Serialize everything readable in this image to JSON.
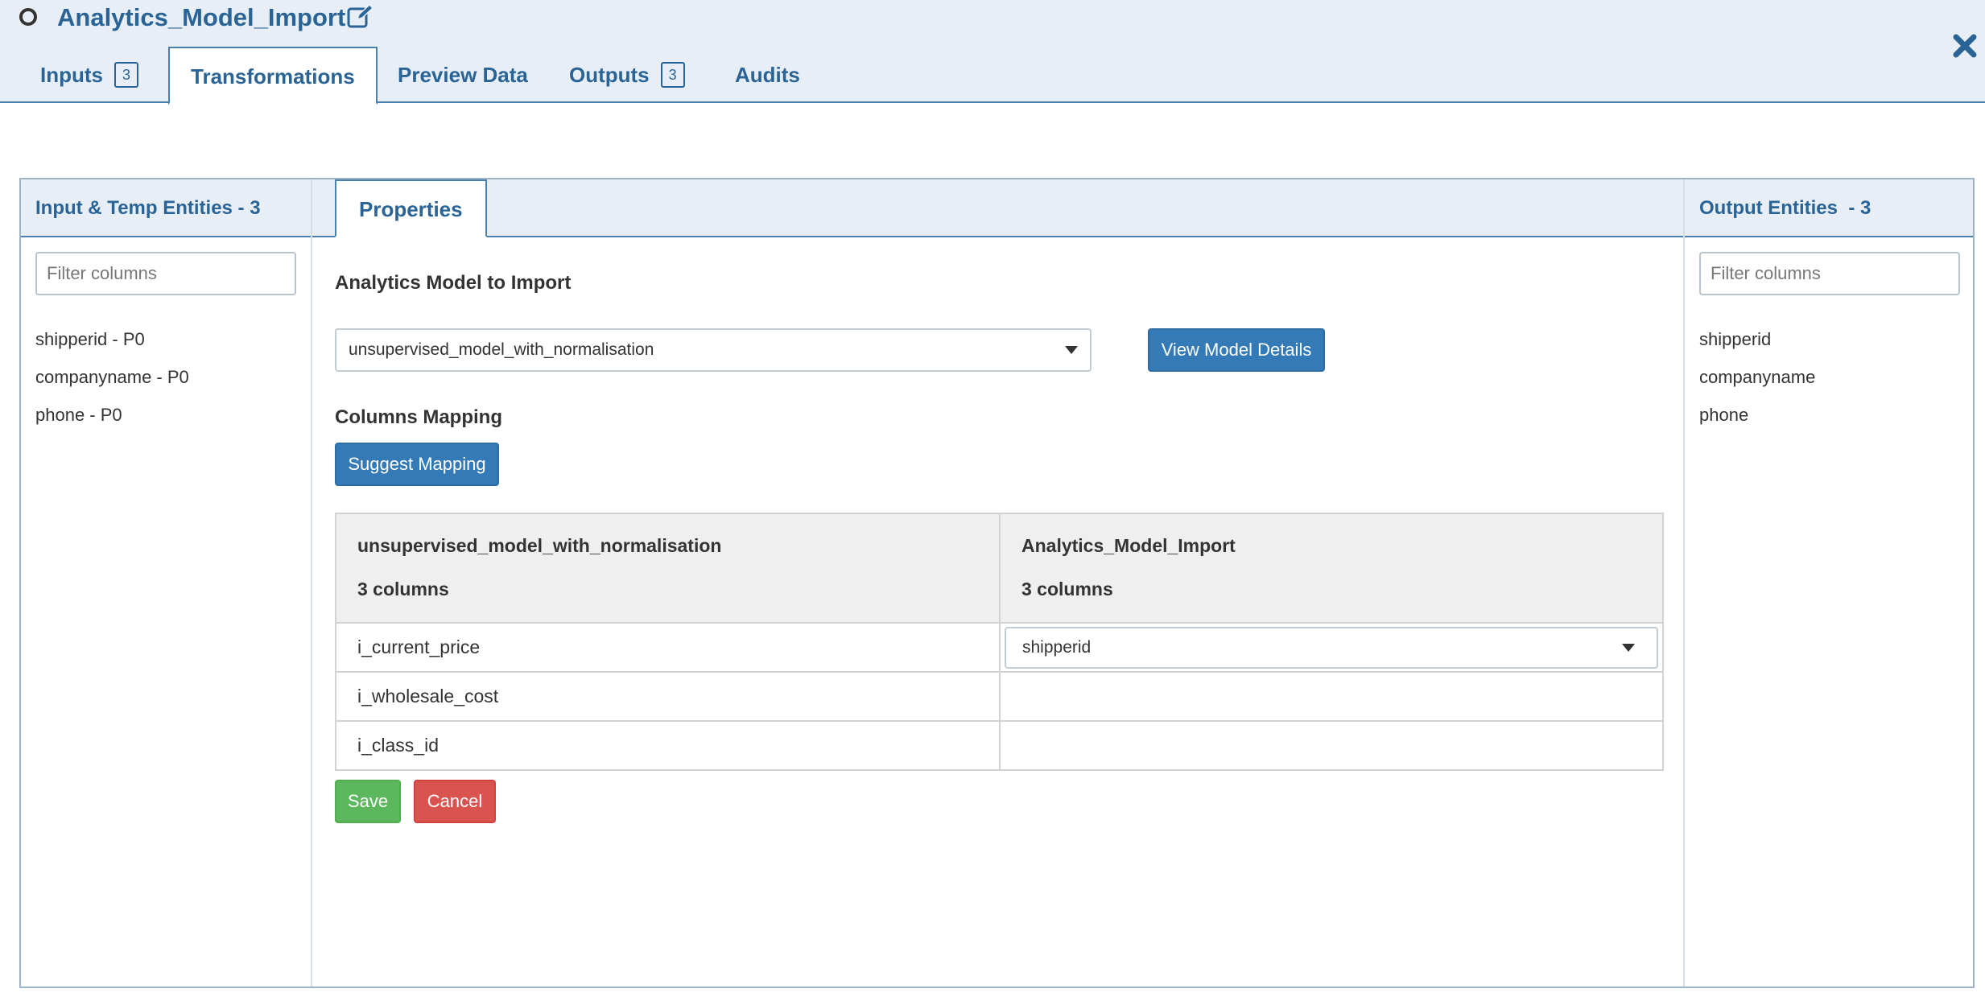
{
  "header": {
    "title": "Analytics_Model_Import",
    "tabs": [
      {
        "label": "Inputs",
        "badge": "3"
      },
      {
        "label": "Transformations"
      },
      {
        "label": "Preview Data"
      },
      {
        "label": "Outputs",
        "badge": "3"
      },
      {
        "label": "Audits"
      }
    ],
    "active_tab": "Transformations"
  },
  "left_panel": {
    "title": "Input & Temp Entities - 3",
    "filter_placeholder": "Filter columns",
    "items": [
      "shipperid - P0",
      "companyname - P0",
      "phone - P0"
    ]
  },
  "center": {
    "tab": "Properties",
    "model_label": "Analytics Model to Import",
    "model_selected": "unsupervised_model_with_normalisation",
    "view_details_button": "View Model Details",
    "columns_mapping_label": "Columns Mapping",
    "suggest_mapping_button": "Suggest Mapping",
    "table": {
      "left_header_name": "unsupervised_model_with_normalisation",
      "left_header_count": "3 columns",
      "right_header_name": "Analytics_Model_Import",
      "right_header_count": "3 columns",
      "rows": [
        {
          "source": "i_current_price",
          "target": "shipperid"
        },
        {
          "source": "i_wholesale_cost",
          "target": ""
        },
        {
          "source": "i_class_id",
          "target": ""
        }
      ]
    },
    "save_button": "Save",
    "cancel_button": "Cancel"
  },
  "right_panel": {
    "title": "Output Entities  - 3",
    "filter_placeholder": "Filter columns",
    "items": [
      "shipperid",
      "companyname",
      "phone"
    ]
  },
  "colors": {
    "accent": "#2a6496",
    "header_bg": "#e7eef6",
    "primary_button": "#337ab7",
    "success_button": "#5cb85c",
    "danger_button": "#d9534f"
  },
  "icons": {
    "status": "circle-outline-icon",
    "edit": "edit-pencil-icon",
    "close": "close-icon",
    "dropdown": "caret-down-icon"
  }
}
